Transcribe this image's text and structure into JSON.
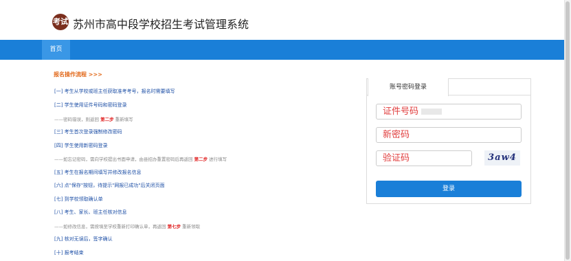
{
  "header": {
    "logo_text": "考试",
    "title": "苏州市高中段学校招生考试管理系统"
  },
  "nav": {
    "home": "首页"
  },
  "flow": {
    "title": "报名操作流程 >>>",
    "steps": [
      "[一] 考生从学校或班主任获取准考考号，报名时需要填写",
      "[二] 学生使用证件号码和密码登录",
      "[三] 考生首次登录强制修改密码",
      "[四] 学生使用新密码登录",
      "[五] 考生在报名期间填写并修改报名信息",
      "[六] 点\"保存\"按钮，待提示\"网报已成功\"后关闭页面",
      "[七] 到学校领取确认单",
      "[八] 考生、家长、班主任核对信息",
      "[九] 核对无误后，签字确认",
      "[十] 报考结束"
    ],
    "notes": [
      {
        "pre": "——密码错误，则返回 ",
        "red": "第二步",
        "post": " 重新填写"
      },
      {
        "pre": "——如忘记密码，需向学校提出书面申请，由县招办重置密码后再返回 ",
        "red": "第二步",
        "post": " 进行填写"
      },
      {
        "pre": "——如修改信息，需按填至学校重新打印确认单，再返回 ",
        "red": "第七步",
        "post": " 重新领取"
      }
    ]
  },
  "login": {
    "tab": "账号密码登录",
    "id_placeholder": "证件号码",
    "password_placeholder": "新密码",
    "captcha_placeholder": "验证码",
    "captcha_text": "3aw4",
    "submit": "登录"
  },
  "colors": {
    "nav": "#1a7fd8",
    "accent": "#e26a1c",
    "link": "#1d4fa6",
    "warning": "#e02020"
  }
}
